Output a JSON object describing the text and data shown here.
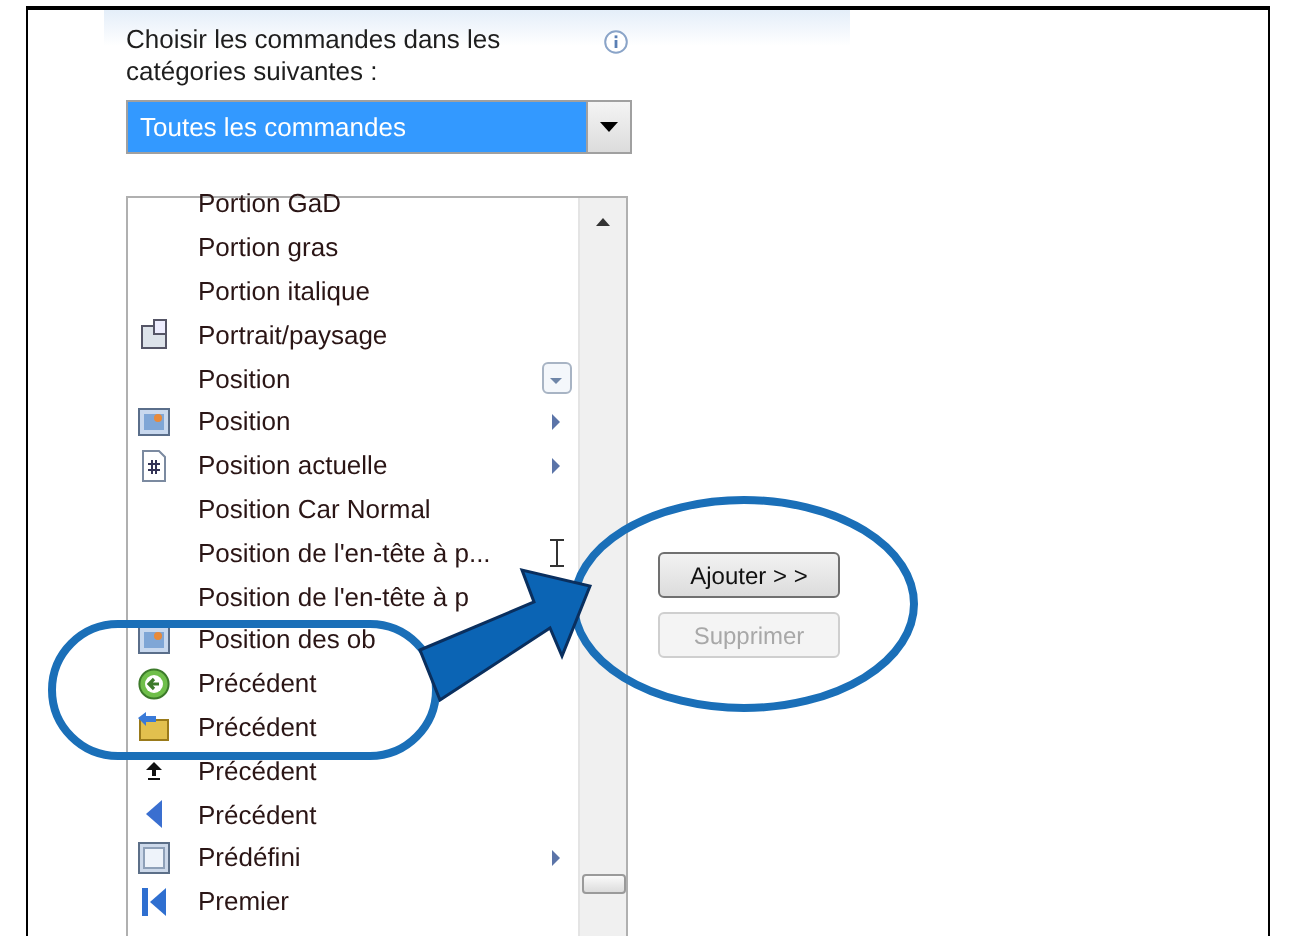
{
  "header": {
    "label": "Choisir les commandes dans les catégories suivantes :"
  },
  "category_select": {
    "value": "Toutes les commandes"
  },
  "commands": [
    {
      "label": "Portion GaD",
      "kind": "plain",
      "submenu": false,
      "dropdown": false,
      "text_entry": false
    },
    {
      "label": "Portion gras",
      "kind": "plain",
      "submenu": false,
      "dropdown": false,
      "text_entry": false
    },
    {
      "label": "Portion italique",
      "kind": "plain",
      "submenu": false,
      "dropdown": false,
      "text_entry": false
    },
    {
      "label": "Portrait/paysage",
      "kind": "orientation",
      "submenu": false,
      "dropdown": false,
      "text_entry": false
    },
    {
      "label": "Position",
      "kind": "plain",
      "submenu": false,
      "dropdown": true,
      "text_entry": false
    },
    {
      "label": "Position",
      "kind": "picture",
      "submenu": true,
      "dropdown": false,
      "text_entry": false
    },
    {
      "label": "Position actuelle",
      "kind": "field",
      "submenu": true,
      "dropdown": false,
      "text_entry": false
    },
    {
      "label": "Position Car Normal",
      "kind": "plain",
      "submenu": false,
      "dropdown": false,
      "text_entry": false
    },
    {
      "label": "Position de l'en-tête à p...",
      "kind": "plain",
      "submenu": false,
      "dropdown": false,
      "text_entry": true
    },
    {
      "label": "Position de l'en-tête à p",
      "kind": "plain",
      "submenu": false,
      "dropdown": false,
      "text_entry": false
    },
    {
      "label": "Position des ob",
      "kind": "picture",
      "submenu": false,
      "dropdown": false,
      "text_entry": false
    },
    {
      "label": "Précédent",
      "kind": "back-circle",
      "submenu": false,
      "dropdown": false,
      "text_entry": false
    },
    {
      "label": "Précédent",
      "kind": "back-folder",
      "submenu": false,
      "dropdown": false,
      "text_entry": false
    },
    {
      "label": "Précédent",
      "kind": "up-small",
      "submenu": false,
      "dropdown": false,
      "text_entry": false
    },
    {
      "label": "Précédent",
      "kind": "back-triangle",
      "submenu": false,
      "dropdown": false,
      "text_entry": false
    },
    {
      "label": "Prédéfini",
      "kind": "frame",
      "submenu": true,
      "dropdown": false,
      "text_entry": false
    },
    {
      "label": "Premier",
      "kind": "first",
      "submenu": false,
      "dropdown": false,
      "text_entry": false
    }
  ],
  "buttons": [
    {
      "label": "Ajouter > >",
      "disabled": false
    },
    {
      "label": "Supprimer",
      "disabled": true
    }
  ]
}
